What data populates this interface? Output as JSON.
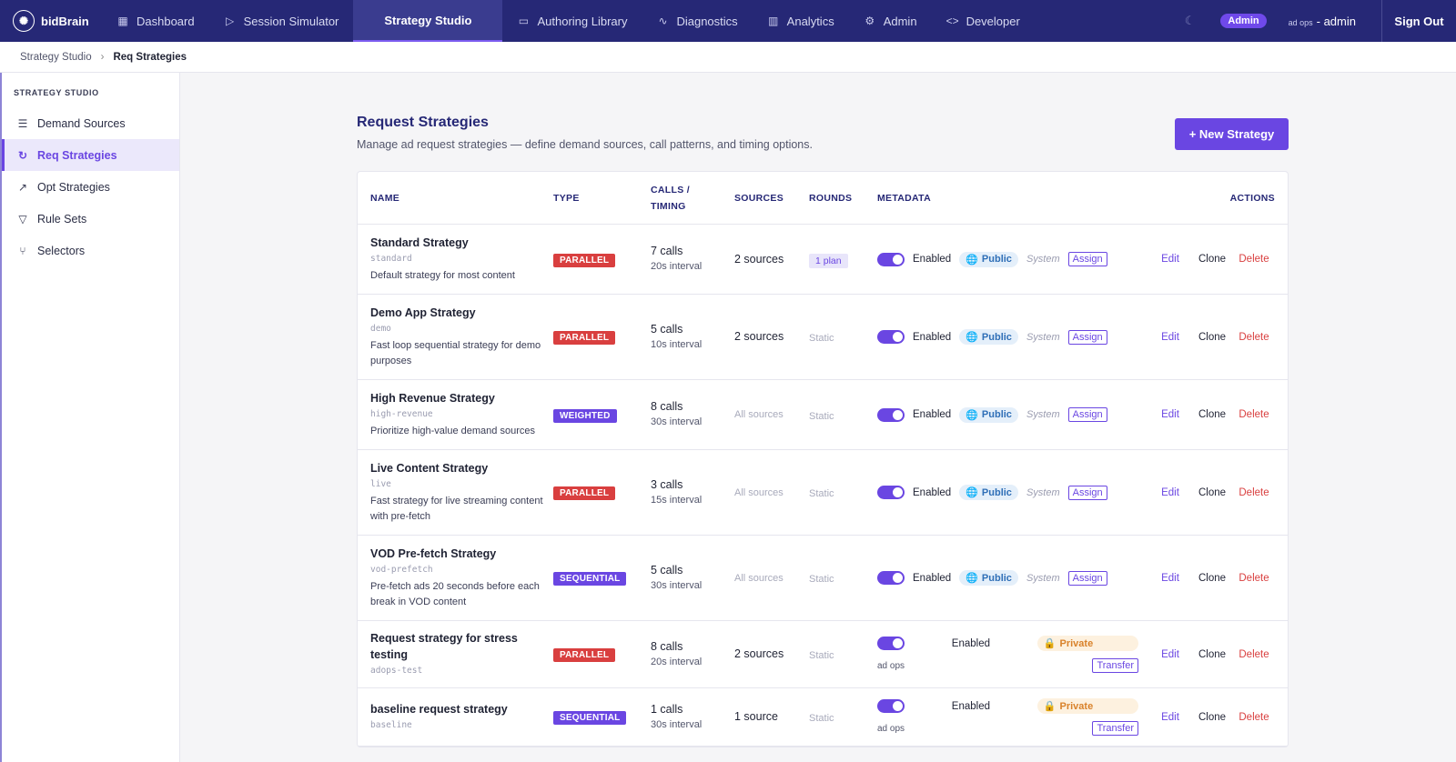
{
  "app": {
    "name": "bidBrain"
  },
  "nav": {
    "items": [
      {
        "label": "Dashboard",
        "icon": "grid-icon"
      },
      {
        "label": "Session Simulator",
        "icon": "play-icon"
      },
      {
        "label": "Strategy Studio",
        "icon": "",
        "active": true
      },
      {
        "label": "Authoring Library",
        "icon": "book-icon"
      },
      {
        "label": "Diagnostics",
        "icon": "pulse-icon"
      },
      {
        "label": "Analytics",
        "icon": "bar-chart-icon"
      },
      {
        "label": "Admin",
        "icon": "gear-icon"
      },
      {
        "label": "Developer",
        "icon": "code-icon"
      }
    ],
    "role_badge": "Admin",
    "user_prefix": "ad ops",
    "user_name": "- admin",
    "signout": "Sign Out"
  },
  "breadcrumb": {
    "parent": "Strategy Studio",
    "current": "Req Strategies"
  },
  "sidebar": {
    "title": "STRATEGY STUDIO",
    "items": [
      {
        "label": "Demand Sources",
        "icon": "database-icon"
      },
      {
        "label": "Req Strategies",
        "icon": "refresh-icon",
        "active": true
      },
      {
        "label": "Opt Strategies",
        "icon": "trend-up-icon"
      },
      {
        "label": "Rule Sets",
        "icon": "filter-icon"
      },
      {
        "label": "Selectors",
        "icon": "branch-icon"
      }
    ]
  },
  "page": {
    "title": "Request Strategies",
    "subtitle": "Manage ad request strategies — define demand sources, call patterns, and timing options.",
    "new_button": "+ New Strategy"
  },
  "table": {
    "headers": {
      "name": "NAME",
      "type": "TYPE",
      "calls_1": "CALLS /",
      "calls_2": "TIMING",
      "sources": "SOURCES",
      "rounds": "ROUNDS",
      "metadata": "METADATA",
      "actions": "ACTIONS"
    },
    "labels": {
      "enabled": "Enabled",
      "public": "Public",
      "private": "Private",
      "system": "System",
      "assign": "Assign",
      "transfer": "Transfer",
      "edit": "Edit",
      "clone": "Clone",
      "delete": "Delete"
    },
    "rows": [
      {
        "title": "Standard Strategy",
        "slug": "standard",
        "desc": "Default strategy for most content",
        "type": "PARALLEL",
        "calls": "7 calls",
        "interval": "20s interval",
        "sources": "2 sources",
        "rounds": "1 plan",
        "visibility": "public",
        "owner": ""
      },
      {
        "title": "Demo App Strategy",
        "slug": "demo",
        "desc": "Fast loop sequential strategy for demo purposes",
        "type": "PARALLEL",
        "calls": "5 calls",
        "interval": "10s interval",
        "sources": "2 sources",
        "rounds": "Static",
        "visibility": "public",
        "owner": ""
      },
      {
        "title": "High Revenue Strategy",
        "slug": "high-revenue",
        "desc": "Prioritize high-value demand sources",
        "type": "WEIGHTED",
        "calls": "8 calls",
        "interval": "30s interval",
        "sources": "All sources",
        "rounds": "Static",
        "visibility": "public",
        "owner": ""
      },
      {
        "title": "Live Content Strategy",
        "slug": "live",
        "desc": "Fast strategy for live streaming content with pre-fetch",
        "type": "PARALLEL",
        "calls": "3 calls",
        "interval": "15s interval",
        "sources": "All sources",
        "rounds": "Static",
        "visibility": "public",
        "owner": ""
      },
      {
        "title": "VOD Pre-fetch Strategy",
        "slug": "vod-prefetch",
        "desc": "Pre-fetch ads 20 seconds before each break in VOD content",
        "type": "SEQUENTIAL",
        "calls": "5 calls",
        "interval": "30s interval",
        "sources": "All sources",
        "rounds": "Static",
        "visibility": "public",
        "owner": ""
      },
      {
        "title": "Request strategy for stress testing",
        "slug": "adops-test",
        "desc": "",
        "type": "PARALLEL",
        "calls": "8 calls",
        "interval": "20s interval",
        "sources": "2 sources",
        "rounds": "Static",
        "visibility": "private",
        "owner": "ad ops"
      },
      {
        "title": "baseline request strategy",
        "slug": "baseline",
        "desc": "",
        "type": "SEQUENTIAL",
        "calls": "1 calls",
        "interval": "30s interval",
        "sources": "1 source",
        "rounds": "Static",
        "visibility": "private",
        "owner": "ad ops"
      }
    ]
  }
}
